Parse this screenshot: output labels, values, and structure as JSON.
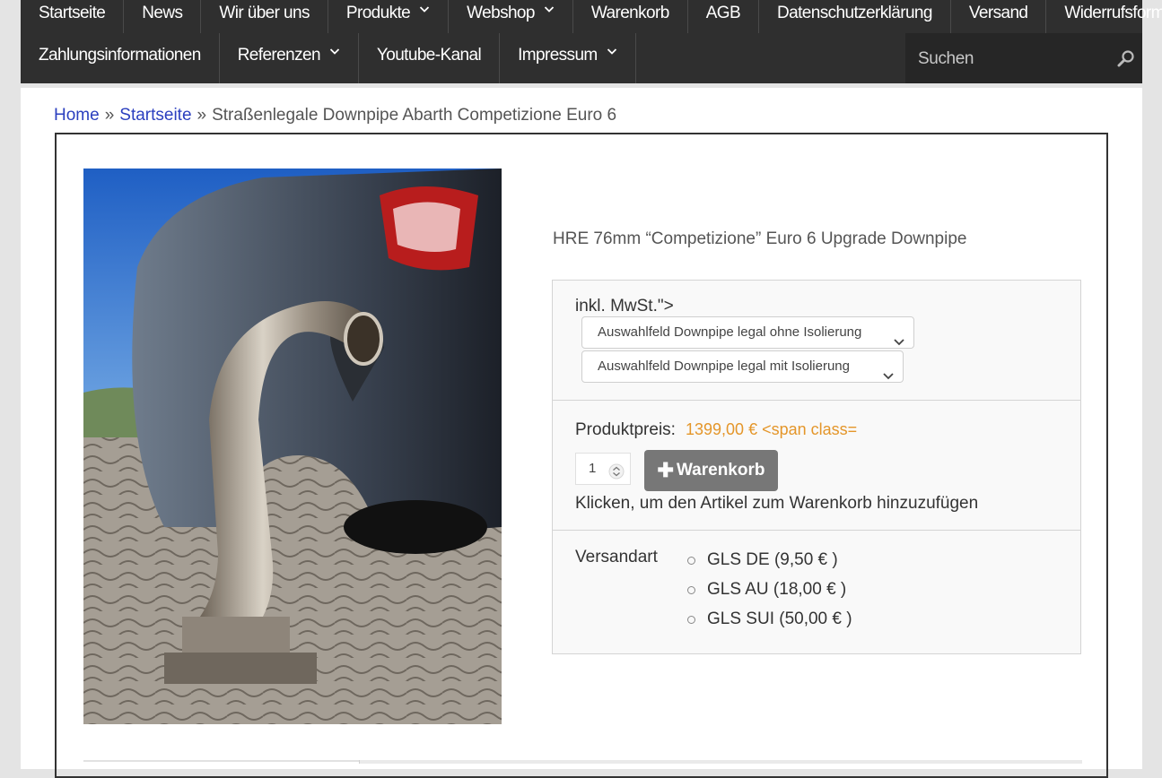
{
  "nav": {
    "row1": [
      {
        "label": "Startseite",
        "has_submenu": false
      },
      {
        "label": "News",
        "has_submenu": false
      },
      {
        "label": "Wir über uns",
        "has_submenu": false
      },
      {
        "label": "Produkte",
        "has_submenu": true
      },
      {
        "label": "Webshop",
        "has_submenu": true
      },
      {
        "label": "Warenkorb",
        "has_submenu": false
      },
      {
        "label": "AGB",
        "has_submenu": false
      },
      {
        "label": "Datenschutzerklärung",
        "has_submenu": false
      },
      {
        "label": "Versand",
        "has_submenu": false
      },
      {
        "label": "Widerrufsformular",
        "has_submenu": false
      }
    ],
    "row2": [
      {
        "label": "Zahlungsinformationen",
        "has_submenu": false
      },
      {
        "label": "Referenzen",
        "has_submenu": true
      },
      {
        "label": "Youtube-Kanal",
        "has_submenu": false
      },
      {
        "label": "Impressum",
        "has_submenu": true
      }
    ],
    "search": {
      "placeholder": "Suchen"
    }
  },
  "breadcrumb": {
    "home": "Home",
    "sep": "»",
    "startseite": "Startseite",
    "current": "Straßenlegale Downpipe Abarth Competizione Euro 6"
  },
  "product": {
    "title": "HRE 76mm “Competizione” Euro 6 Upgrade Downpipe",
    "mwst_text": "inkl. MwSt.\">",
    "select1": "Auswahlfeld Downpipe legal ohne Isolierung",
    "select2": "Auswahlfeld Downpipe legal mit Isolierung",
    "price_label": "Produktpreis:",
    "price_value": "1399,00 € <span class=",
    "quantity": "1",
    "cart_button": "Warenkorb",
    "cart_hint": "Klicken, um den Artikel zum Warenkorb hinzuzufügen",
    "shipping_label": "Versandart",
    "shipping_options": [
      "GLS DE (9,50 € )",
      "GLS AU (18,00 € )",
      "GLS SUI (50,00 € )"
    ]
  },
  "colors": {
    "nav_bg": "#2f2f2f",
    "link": "#2b3fbf",
    "price": "#e4962a",
    "button": "#777777"
  }
}
